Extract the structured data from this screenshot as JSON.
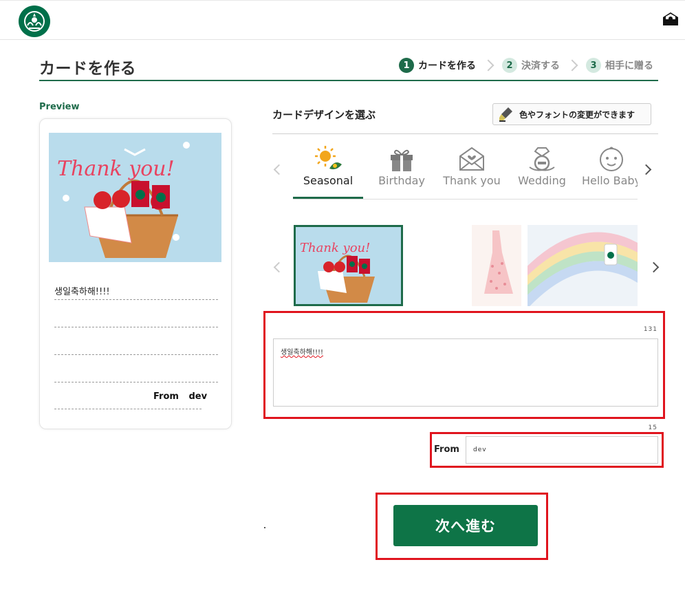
{
  "page": {
    "title": "カードを作る"
  },
  "steps": [
    {
      "num": "1",
      "label": "カードを作る",
      "active": true
    },
    {
      "num": "2",
      "label": "決済する",
      "active": false
    },
    {
      "num": "3",
      "label": "相手に贈る",
      "active": false
    }
  ],
  "preview": {
    "label": "Preview",
    "message": "생일축하해!!!!",
    "from_label": "From",
    "from_name": "dev",
    "card_text": "Thank you!"
  },
  "design": {
    "heading": "カードデザインを選ぶ",
    "font_button": "色やフォントの変更ができます",
    "categories": [
      {
        "label": "Seasonal",
        "icon": "sun-leaf-icon",
        "active": true
      },
      {
        "label": "Birthday",
        "icon": "gift-icon",
        "active": false
      },
      {
        "label": "Thank you",
        "icon": "envelope-heart-icon",
        "active": false
      },
      {
        "label": "Wedding",
        "icon": "ring-icon",
        "active": false
      },
      {
        "label": "Hello Baby",
        "icon": "baby-face-icon",
        "active": false
      }
    ]
  },
  "form": {
    "message_count": "131",
    "message_value": "생일축하해!!!!",
    "from_count": "15",
    "from_label": "From",
    "from_value": "dev"
  },
  "actions": {
    "next_label": "次へ進む"
  },
  "colors": {
    "brand": "#1e6b4a",
    "button": "#0e7447",
    "highlight": "#e0141e"
  }
}
